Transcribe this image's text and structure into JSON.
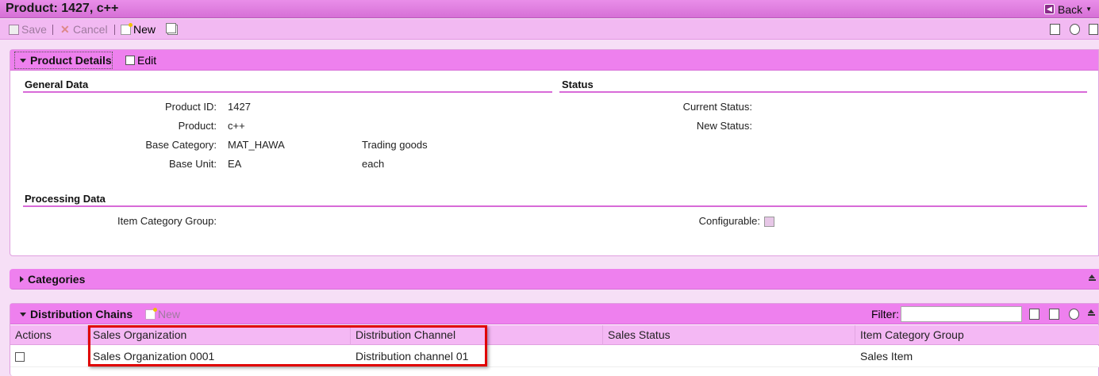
{
  "window": {
    "title": "Product: 1427, c++",
    "back_label": "Back"
  },
  "toolbar": {
    "save_label": "Save",
    "cancel_label": "Cancel",
    "new_label": "New"
  },
  "product_details": {
    "title": "Product Details",
    "edit_label": "Edit",
    "general_data": {
      "title": "General Data",
      "fields": [
        {
          "label": "Product ID:",
          "value": "1427",
          "extra": ""
        },
        {
          "label": "Product:",
          "value": "c++",
          "extra": ""
        },
        {
          "label": "Base Category:",
          "value": "MAT_HAWA",
          "extra": "Trading goods"
        },
        {
          "label": "Base Unit:",
          "value": "EA",
          "extra": "each"
        }
      ]
    },
    "status": {
      "title": "Status",
      "current_label": "Current Status:",
      "new_label": "New Status:"
    },
    "processing_data": {
      "title": "Processing Data",
      "item_category_group_label": "Item Category Group:",
      "configurable_label": "Configurable:"
    }
  },
  "categories": {
    "title": "Categories"
  },
  "distribution_chains": {
    "title": "Distribution Chains",
    "new_label": "New",
    "filter_label": "Filter:",
    "filter_value": "",
    "columns": [
      "Actions",
      "Sales Organization",
      "Distribution Channel",
      "Sales Status",
      "Item Category Group"
    ],
    "rows": [
      {
        "sales_org": "Sales Organization 0001",
        "channel": "Distribution channel 01",
        "status": "",
        "item_group": "Sales Item"
      }
    ]
  }
}
